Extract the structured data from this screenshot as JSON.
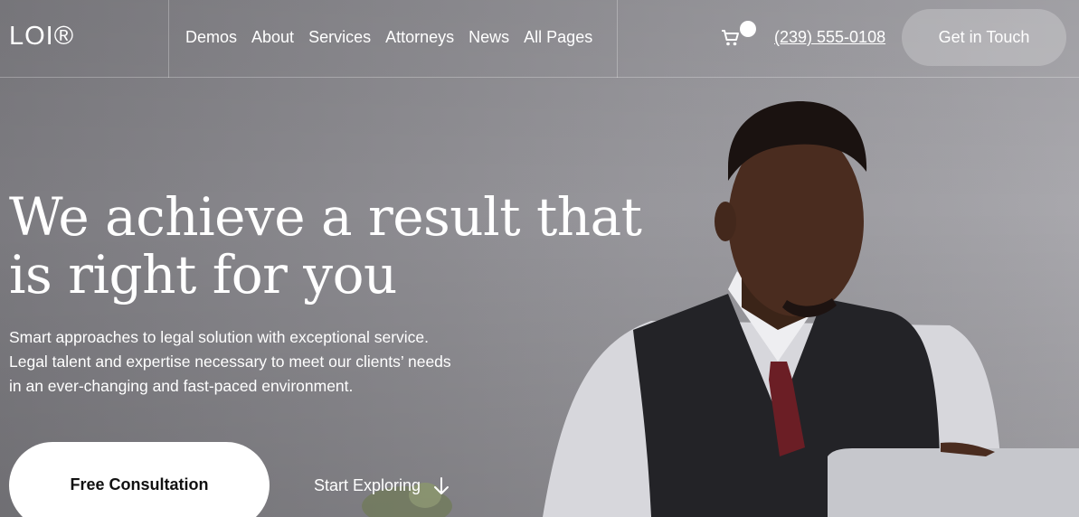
{
  "header": {
    "logo": "LOI®",
    "nav": [
      "Demos",
      "About",
      "Services",
      "Attorneys",
      "News",
      "All Pages"
    ],
    "phone": "(239) 555-0108",
    "cta": "Get in Touch"
  },
  "hero": {
    "headline": "We achieve a result that is right for you",
    "subtext": "Smart approaches to legal solution with exceptional service. Legal talent and expertise necessary to meet our clients’ needs in an ever-changing and fast-paced environment.",
    "primary_button": "Free Consultation",
    "secondary_link": "Start Exploring"
  },
  "icons": {
    "cart": "cart-icon",
    "arrow": "arrow-down-icon"
  }
}
